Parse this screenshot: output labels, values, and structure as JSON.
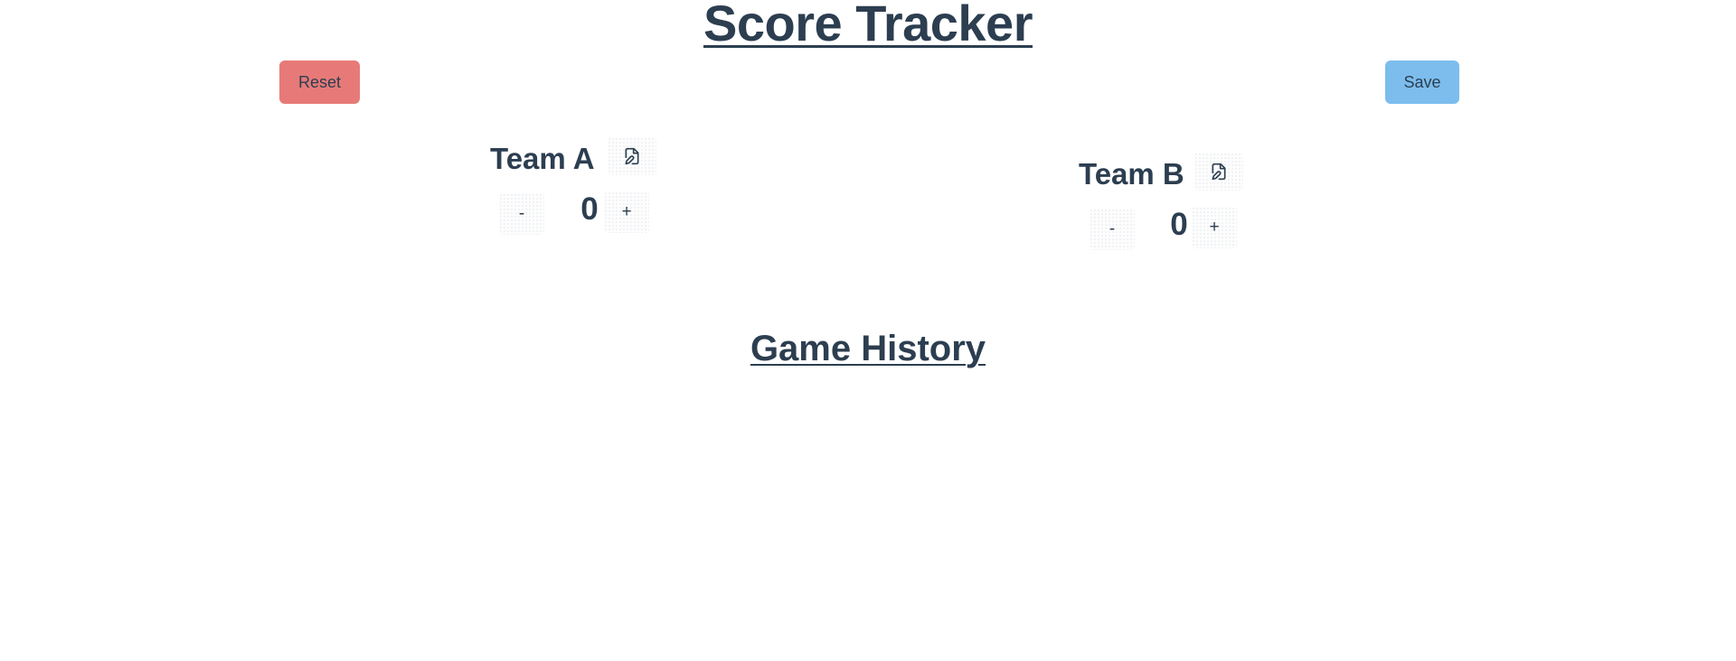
{
  "app": {
    "title": "Score Tracker"
  },
  "toolbar": {
    "reset_label": "Reset",
    "save_label": "Save"
  },
  "teams": [
    {
      "name": "Team A",
      "score": "0",
      "decrement_label": "-",
      "increment_label": "+",
      "edit_icon": "file-edit-icon"
    },
    {
      "name": "Team B",
      "score": "0",
      "decrement_label": "-",
      "increment_label": "+",
      "edit_icon": "file-edit-icon"
    }
  ],
  "history": {
    "title": "Game History",
    "entries": []
  },
  "colors": {
    "text": "#2c3e50",
    "reset": "#e77a78",
    "save": "#7cbdee"
  }
}
